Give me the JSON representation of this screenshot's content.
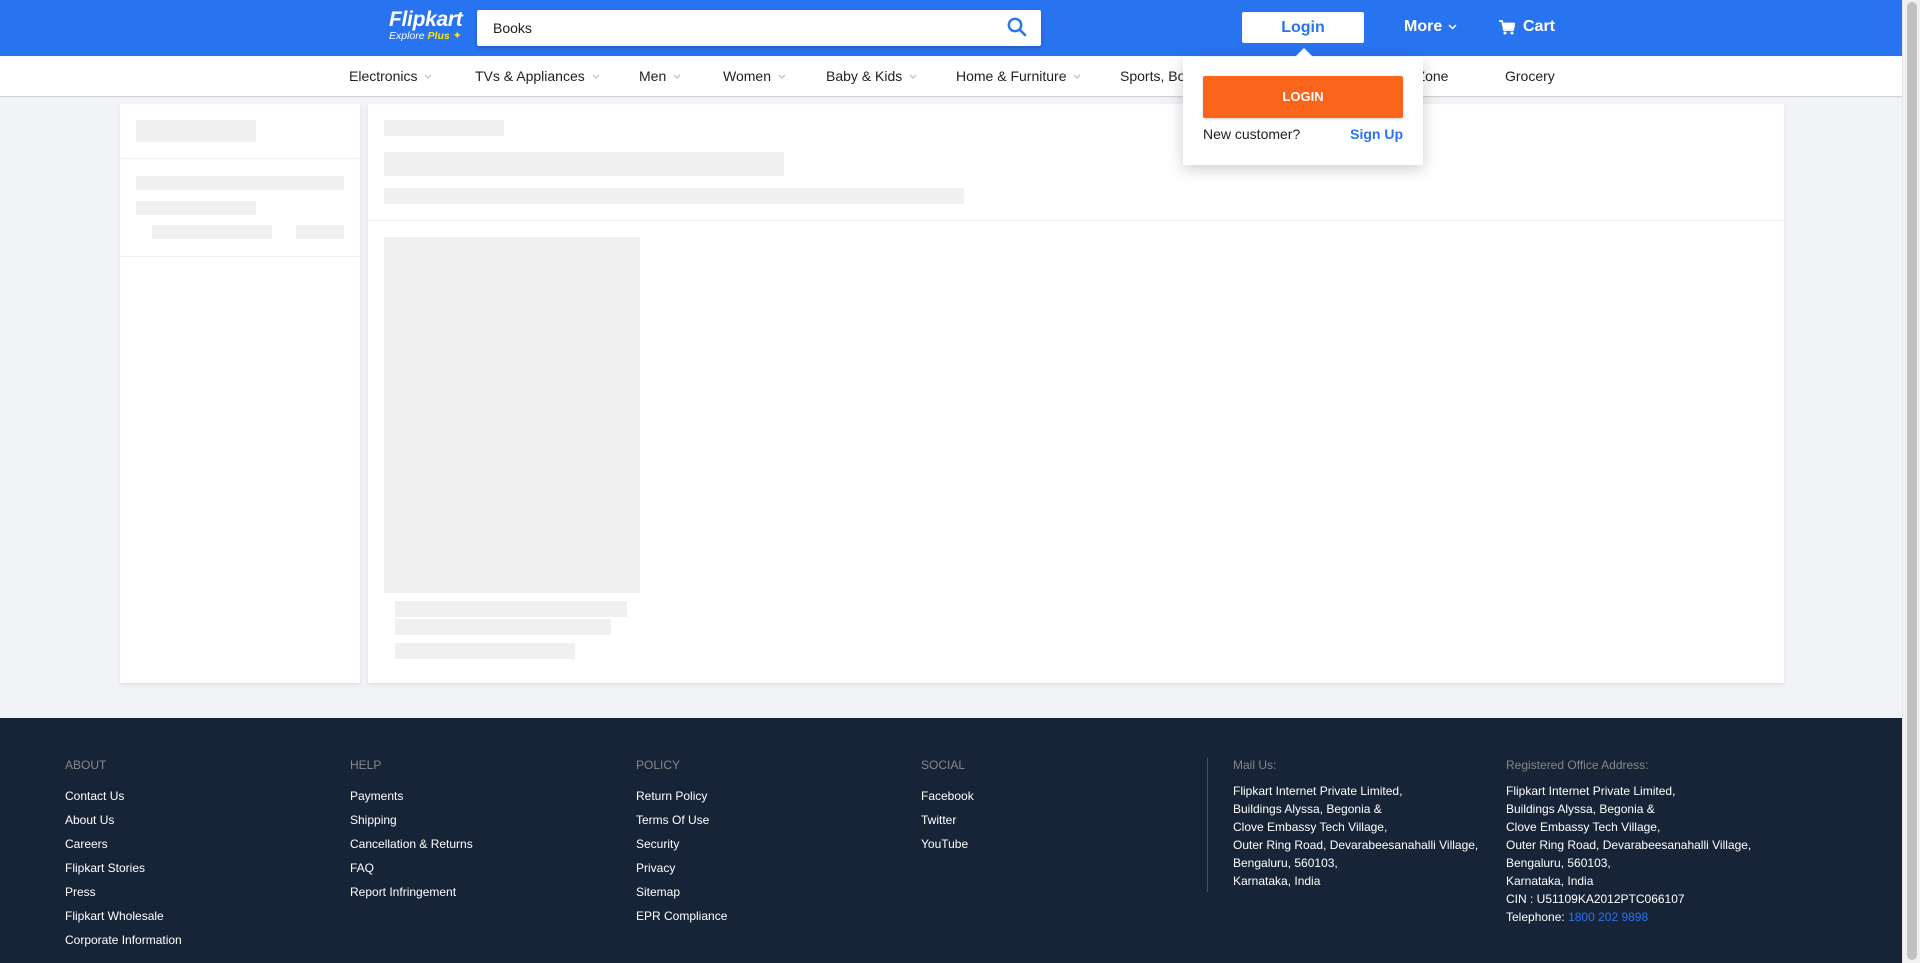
{
  "header": {
    "logo_main": "Flipkart",
    "logo_sub": "Explore",
    "logo_plus": "Plus",
    "search_value": "Books",
    "login_label": "Login",
    "more_label": "More",
    "cart_label": "Cart",
    "brand_color": "#2874f0"
  },
  "nav": {
    "items": [
      {
        "label": "Electronics"
      },
      {
        "label": "TVs & Appliances"
      },
      {
        "label": "Men"
      },
      {
        "label": "Women"
      },
      {
        "label": "Baby & Kids"
      },
      {
        "label": "Home & Furniture"
      },
      {
        "label": "Sports, Bo"
      },
      {
        "label": "r Zone"
      },
      {
        "label": "Grocery"
      }
    ]
  },
  "login_dropdown": {
    "login_button": "LOGIN",
    "new_customer": "New customer?",
    "sign_up": "Sign Up",
    "login_color": "#fb641b"
  },
  "footer": {
    "about": {
      "title": "ABOUT",
      "links": [
        "Contact Us",
        "About Us",
        "Careers",
        "Flipkart Stories",
        "Press",
        "Flipkart Wholesale",
        "Corporate Information"
      ]
    },
    "help": {
      "title": "HELP",
      "links": [
        "Payments",
        "Shipping",
        "Cancellation & Returns",
        "FAQ",
        "Report Infringement"
      ]
    },
    "policy": {
      "title": "POLICY",
      "links": [
        "Return Policy",
        "Terms Of Use",
        "Security",
        "Privacy",
        "Sitemap",
        "EPR Compliance"
      ]
    },
    "social": {
      "title": "SOCIAL",
      "links": [
        "Facebook",
        "Twitter",
        "YouTube"
      ]
    },
    "mail": {
      "title": "Mail Us:",
      "lines": [
        "Flipkart Internet Private Limited,",
        "Buildings Alyssa, Begonia &",
        "Clove Embassy Tech Village,",
        "Outer Ring Road, Devarabeesanahalli Village,",
        "Bengaluru, 560103,",
        "Karnataka, India"
      ]
    },
    "office": {
      "title": "Registered Office Address:",
      "lines": [
        "Flipkart Internet Private Limited,",
        "Buildings Alyssa, Begonia &",
        "Clove Embassy Tech Village,",
        "Outer Ring Road, Devarabeesanahalli Village,",
        "Bengaluru, 560103,",
        "Karnataka, India",
        "CIN : U51109KA2012PTC066107"
      ],
      "telephone_label": "Telephone: ",
      "telephone": "1800 202 9898"
    }
  }
}
